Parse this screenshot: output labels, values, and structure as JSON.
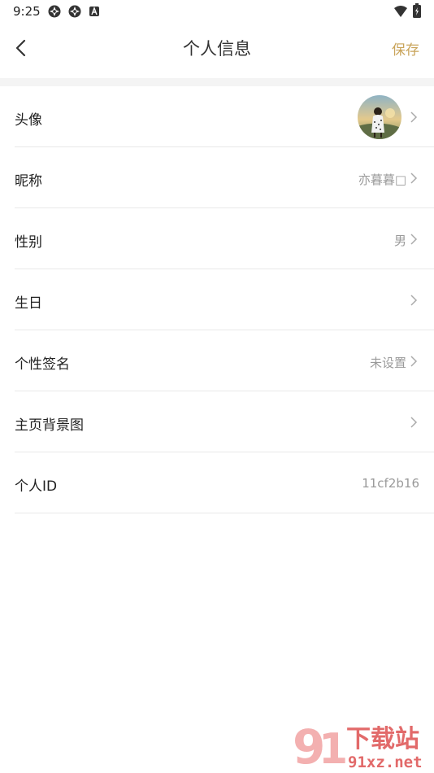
{
  "status_bar": {
    "time": "9:25"
  },
  "header": {
    "title": "个人信息",
    "save_label": "保存"
  },
  "rows": [
    {
      "label": "头像",
      "value": ""
    },
    {
      "label": "昵称",
      "value": "亦暮暮□"
    },
    {
      "label": "性别",
      "value": "男"
    },
    {
      "label": "生日",
      "value": ""
    },
    {
      "label": "个性签名",
      "value": "未设置"
    },
    {
      "label": "主页背景图",
      "value": ""
    },
    {
      "label": "个人ID",
      "value": "11cf2b16"
    }
  ],
  "watermark": {
    "logo_text": "下载站",
    "url": "91xz.net"
  },
  "colors": {
    "accent": "#c9a45a",
    "text": "#222222",
    "muted": "#9a9a9a",
    "divider": "#e8e8e8"
  }
}
